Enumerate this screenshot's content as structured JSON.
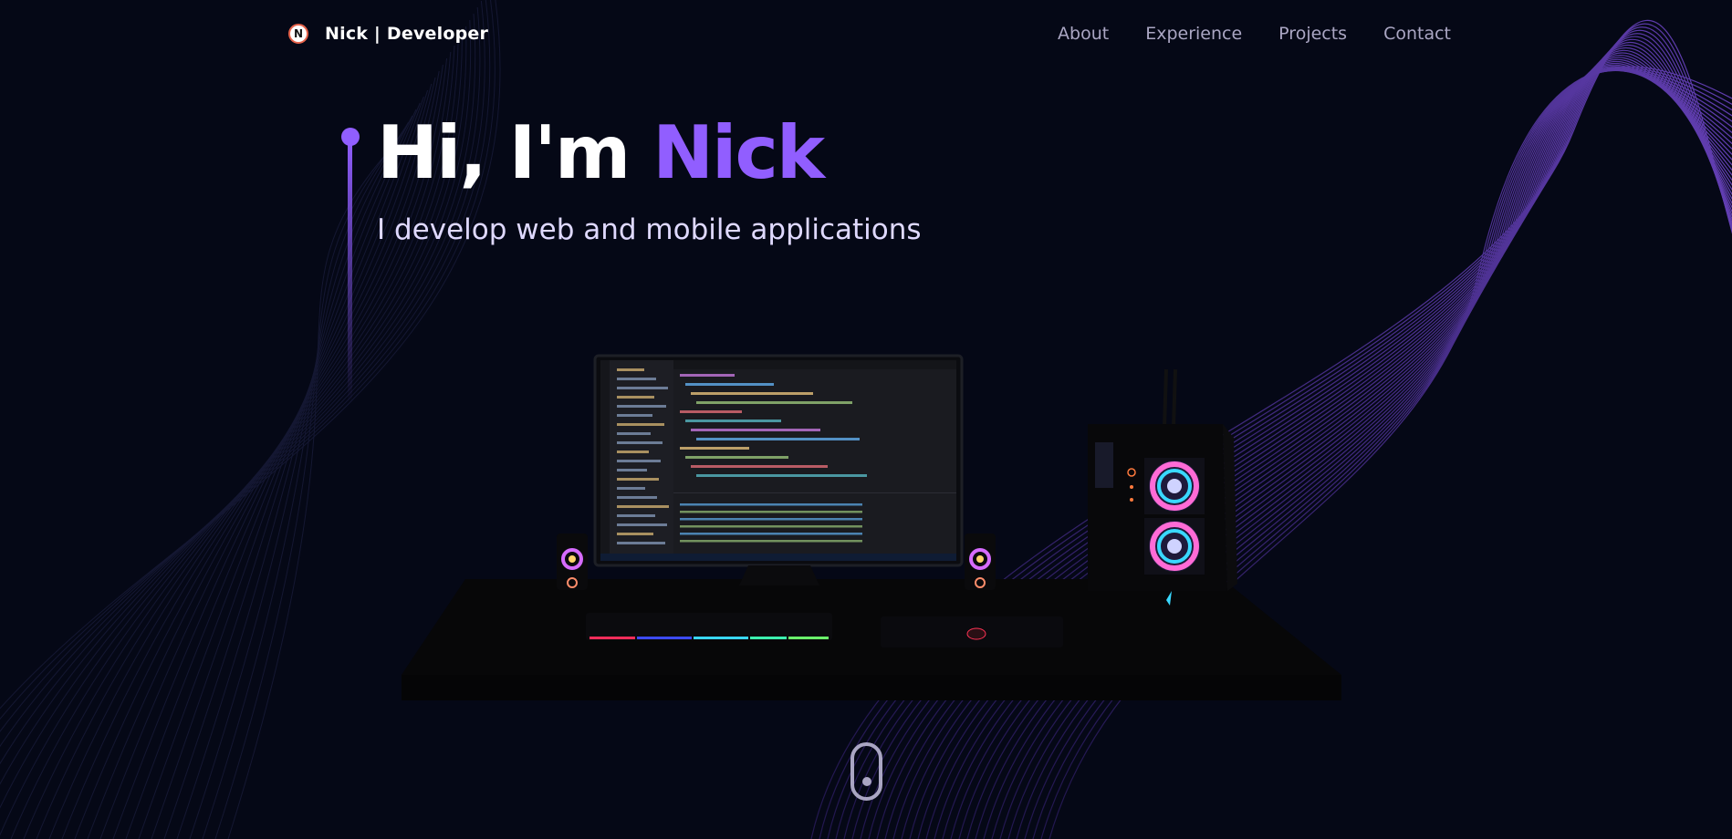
{
  "brand": {
    "logo_letter": "N",
    "name": "Nick | Developer"
  },
  "nav": {
    "links": [
      "About",
      "Experience",
      "Projects",
      "Contact"
    ]
  },
  "hero": {
    "greeting": "Hi, I'm ",
    "name": "Nick",
    "subtitle": "I develop web and mobile applications"
  },
  "colors": {
    "background": "#050816",
    "accent": "#915eff",
    "secondary_text": "#aaa6c3"
  },
  "icons": {
    "logo": "n-logo-icon",
    "scroll": "scroll-down-indicator"
  }
}
